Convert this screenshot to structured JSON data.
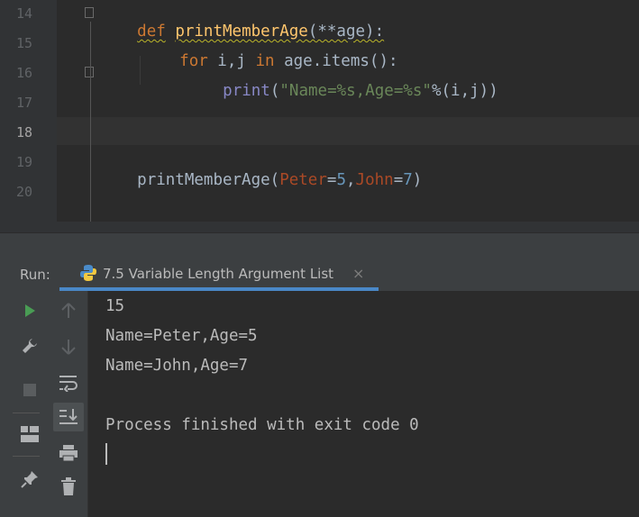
{
  "editor": {
    "line_numbers": [
      "14",
      "15",
      "16",
      "17",
      "18",
      "19",
      "20"
    ],
    "active_line": "18",
    "code": {
      "l14_kw": "def",
      "l14_fn": "printMemberAge",
      "l14_rest": "(**age):",
      "l15_kw": "for",
      "l15_a": " i",
      "l15_comma": ",",
      "l15_b": "j ",
      "l15_in": "in",
      "l15_rest": " age.items():",
      "l16_print": "print",
      "l16_open": "(",
      "l16_str": "\"Name=%s,Age=%s\"",
      "l16_pct": "%(i",
      "l16_comma": ",",
      "l16_rest": "j))",
      "l19_fn": "printMemberAge(",
      "l19_p1": "Peter",
      "l19_eq1": "=",
      "l19_n1": "5",
      "l19_comma": ",",
      "l19_p2": "John",
      "l19_eq2": "=",
      "l19_n2": "7",
      "l19_close": ")"
    }
  },
  "run": {
    "label": "Run:",
    "tab_title": "7.5 Variable Length Argument List",
    "close_glyph": "×",
    "toolbar_icons": [
      "run-icon",
      "up-arrow-icon",
      "wrench-icon",
      "down-arrow-icon",
      "stop-icon",
      "soft-wrap-icon",
      "layout-icon",
      "scroll-to-end-icon",
      "print-icon",
      "pin-icon",
      "trash-icon"
    ],
    "output": [
      "15",
      "Name=Peter,Age=5",
      "Name=John,Age=7",
      "",
      "Process finished with exit code 0"
    ]
  },
  "colors": {
    "keyword": "#cc7832",
    "function": "#ffc66d",
    "string": "#6a8759",
    "param": "#aa4926",
    "number": "#6897bb",
    "accent": "#4a88c7",
    "run_green": "#499c54"
  }
}
